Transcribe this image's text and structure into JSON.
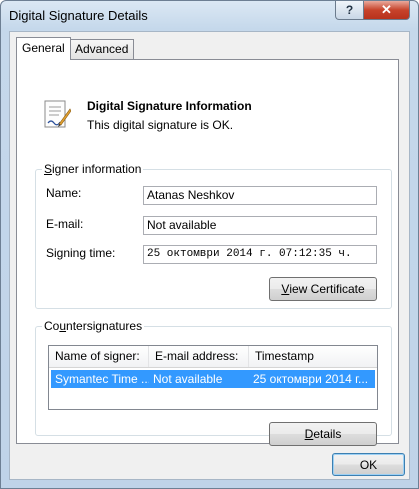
{
  "window": {
    "title": "Digital Signature Details"
  },
  "titlebar": {
    "help_label": "?",
    "close_label": "✕"
  },
  "tabs": [
    {
      "label": "General",
      "active": true
    },
    {
      "label": "Advanced",
      "active": false
    }
  ],
  "info": {
    "title": "Digital Signature Information",
    "status": "This digital signature is OK.",
    "icon": "certificate-icon"
  },
  "signer": {
    "group_label_prefix": "S",
    "group_label_rest": "igner information",
    "name_label": "Name:",
    "name_value": "Atanas Neshkov",
    "email_label": "E-mail:",
    "email_value": "Not available",
    "time_label": "Signing time:",
    "time_value": " 25 октомври 2014 г. 07:12:35 ч.",
    "view_cert_prefix": "V",
    "view_cert_rest": "iew Certificate"
  },
  "counter": {
    "group_label_prefix": "Co",
    "group_label_u": "u",
    "group_label_rest": "ntersignatures",
    "columns": [
      "Name of signer:",
      "E-mail address:",
      "Timestamp"
    ],
    "rows": [
      {
        "name": "Symantec Time ...",
        "email": "Not available",
        "timestamp": "25 октомври 2014 г..."
      }
    ],
    "details_prefix": "D",
    "details_rest": "etails"
  },
  "footer": {
    "ok_label": "OK"
  },
  "colors": {
    "selection": "#3399ff",
    "close_button": "#c7432b"
  }
}
